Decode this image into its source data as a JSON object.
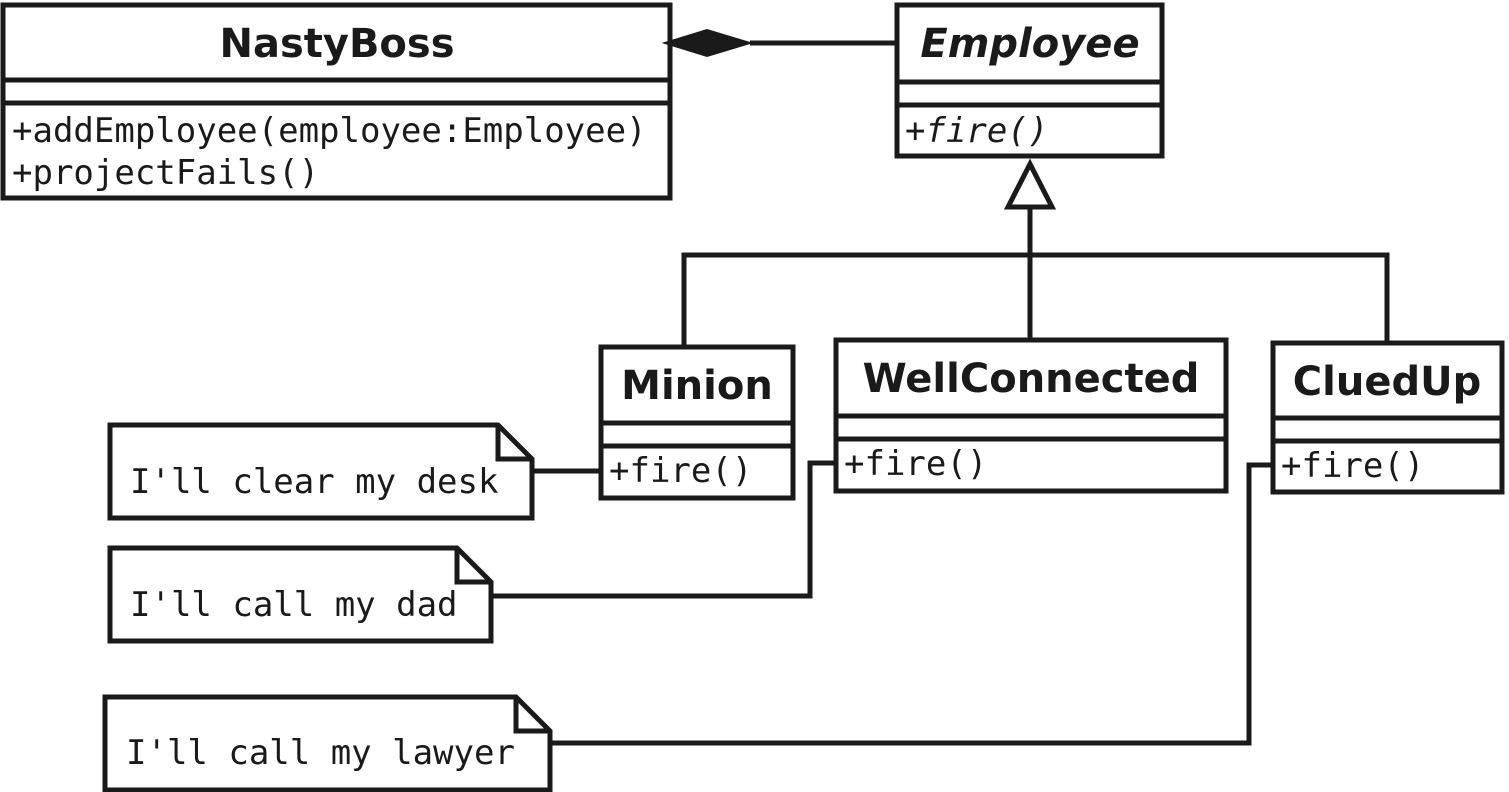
{
  "classes": {
    "nastyboss": {
      "name": "NastyBoss",
      "methods": [
        "+addEmployee(employee:Employee)",
        "+projectFails()"
      ]
    },
    "employee": {
      "name": "Employee",
      "abstract": true,
      "methods": [
        "+fire()"
      ]
    },
    "minion": {
      "name": "Minion",
      "methods": [
        "+fire()"
      ]
    },
    "wellconnected": {
      "name": "WellConnected",
      "methods": [
        "+fire()"
      ]
    },
    "cluedup": {
      "name": "CluedUp",
      "methods": [
        "+fire()"
      ]
    }
  },
  "notes": [
    "I'll clear my desk",
    "I'll call my dad",
    "I'll call my lawyer"
  ],
  "relations": [
    {
      "type": "composition",
      "from": "NastyBoss",
      "to": "Employee"
    },
    {
      "type": "generalization",
      "children": [
        "Minion",
        "WellConnected",
        "CluedUp"
      ],
      "parent": "Employee"
    }
  ]
}
